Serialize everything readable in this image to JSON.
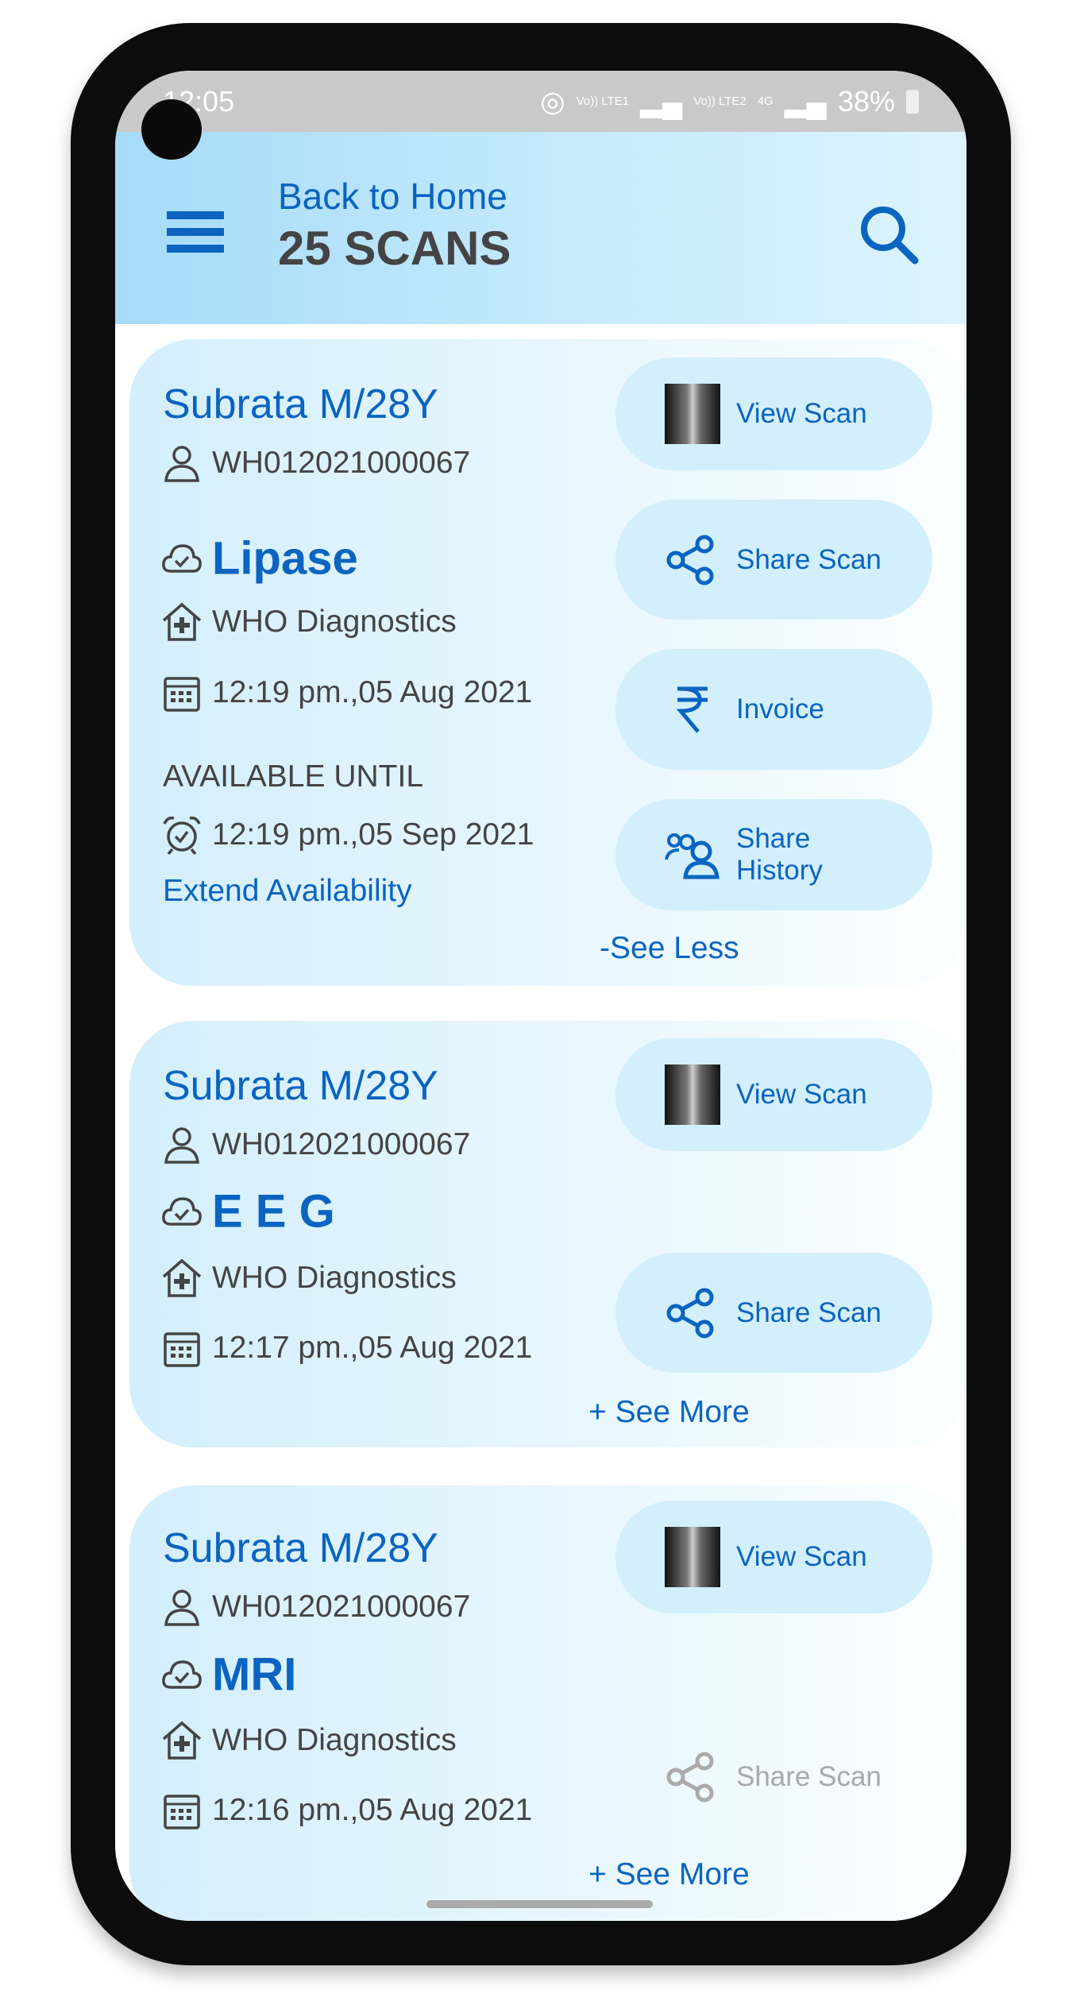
{
  "status_bar": {
    "time": "12:05",
    "network1": "Vo)) LTE1",
    "network2": "Vo)) LTE2",
    "net_type": "4G",
    "battery": "38%"
  },
  "header": {
    "back_label": "Back to Home",
    "title": "25 SCANS",
    "menu_icon": "hamburger-icon",
    "search_icon": "search-icon"
  },
  "colors": {
    "accent": "#0a64c0",
    "text": "#444444",
    "button_bg": "#d3effc",
    "header_bg": "#a6dbf8"
  },
  "scans": [
    {
      "patient": "Subrata M/28Y",
      "patient_id": "WH012021000067",
      "test": "Lipase",
      "lab": "WHO Diagnostics",
      "datetime": "12:19 pm.,05 Aug 2021",
      "available_label": "AVAILABLE UNTIL",
      "available_until": "12:19 pm.,05 Sep 2021",
      "extend_label": "Extend Availability",
      "toggle_label": "-See Less",
      "buttons": {
        "view": "View Scan",
        "share": "Share Scan",
        "invoice": "Invoice",
        "history_line1": "Share",
        "history_line2": "History"
      }
    },
    {
      "patient": "Subrata M/28Y",
      "patient_id": "WH012021000067",
      "test": "E E G",
      "lab": "WHO Diagnostics",
      "datetime": "12:17 pm.,05 Aug 2021",
      "toggle_label": "+ See More",
      "buttons": {
        "view": "View Scan",
        "share": "Share Scan"
      }
    },
    {
      "patient": "Subrata M/28Y",
      "patient_id": "WH012021000067",
      "test": "MRI",
      "lab": "WHO Diagnostics",
      "datetime": "12:16 pm.,05 Aug 2021",
      "toggle_label": "+ See More",
      "buttons": {
        "view": "View Scan",
        "share": "Share Scan",
        "share_disabled": true
      }
    }
  ]
}
